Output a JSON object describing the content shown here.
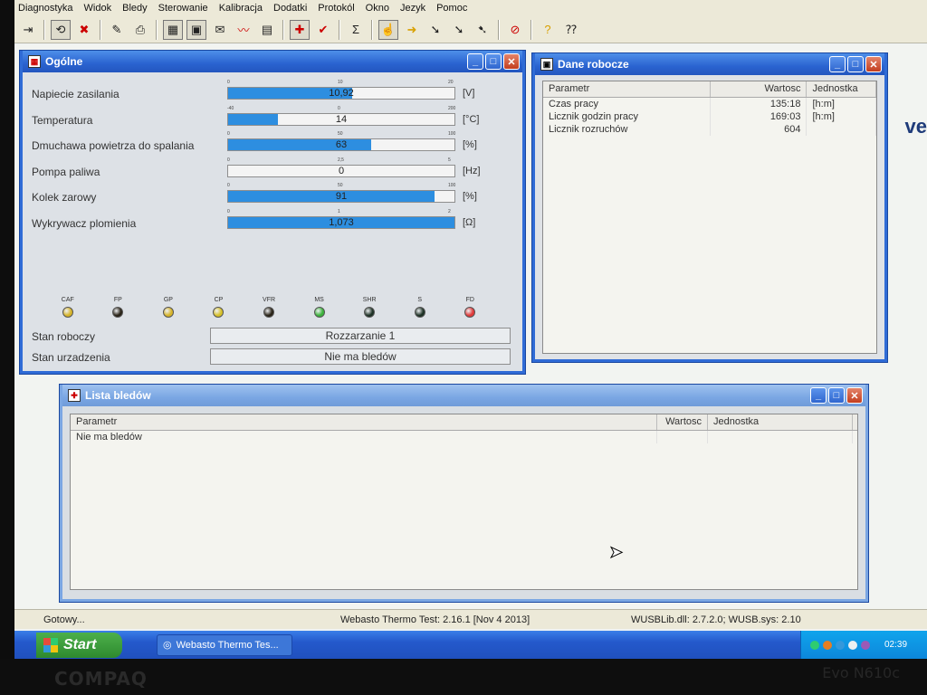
{
  "menu": [
    "Diagnostyka",
    "Widok",
    "Bledy",
    "Sterowanie",
    "Kalibracja",
    "Dodatki",
    "Protokól",
    "Okno",
    "Jezyk",
    "Pomoc"
  ],
  "ogolne": {
    "title": "Ogólne",
    "measurements": [
      {
        "label": "Napiecie zasilania",
        "value": "10,92",
        "unit": "[V]",
        "fill": 0.546,
        "scale": [
          "0",
          "10",
          "20"
        ]
      },
      {
        "label": "Temperatura",
        "value": "14",
        "unit": "[°C]",
        "fill": 0.22,
        "scale": [
          "-40",
          "0",
          "200"
        ]
      },
      {
        "label": "Dmuchawa powietrza do spalania",
        "value": "63",
        "unit": "[%]",
        "fill": 0.63,
        "scale": [
          "0",
          "50",
          "100"
        ]
      },
      {
        "label": "Pompa paliwa",
        "value": "0",
        "unit": "[Hz]",
        "fill": 0,
        "scale": [
          "0",
          "2,5",
          "5"
        ]
      },
      {
        "label": "Kolek zarowy",
        "value": "91",
        "unit": "[%]",
        "fill": 0.91,
        "scale": [
          "0",
          "50",
          "100"
        ]
      },
      {
        "label": "Wykrywacz plomienia",
        "value": "1,073",
        "unit": "[Ω]",
        "fill": 1.0,
        "scale": [
          "0",
          "1",
          "2"
        ]
      }
    ],
    "leds": [
      {
        "name": "CAF",
        "color": "#d6b42a"
      },
      {
        "name": "FP",
        "color": "#2a2418"
      },
      {
        "name": "GP",
        "color": "#d6b42a"
      },
      {
        "name": "CP",
        "color": "#d6c02a"
      },
      {
        "name": "VFR",
        "color": "#2a2418"
      },
      {
        "name": "MS",
        "color": "#3cb23c"
      },
      {
        "name": "SHR",
        "color": "#1e3226"
      },
      {
        "name": "S",
        "color": "#1e3226"
      },
      {
        "name": "FD",
        "color": "#e03a3a"
      }
    ],
    "stan_roboczy_label": "Stan roboczy",
    "stan_roboczy_value": "Rozzarzanie 1",
    "stan_urzadzenia_label": "Stan urzadzenia",
    "stan_urzadzenia_value": "Nie ma bledów"
  },
  "dane": {
    "title": "Dane robocze",
    "headers": [
      "Parametr",
      "Wartosc",
      "Jednostka"
    ],
    "rows": [
      [
        "Czas pracy",
        "135:18",
        "[h:m]"
      ],
      [
        "Licznik godzin pracy",
        "169:03",
        "[h:m]"
      ],
      [
        "Licznik rozruchów",
        "604",
        ""
      ]
    ]
  },
  "bledy": {
    "title": "Lista bledów",
    "headers": [
      "Parametr",
      "Wartosc",
      "Jednostka"
    ],
    "rows": [
      [
        "Nie ma bledów",
        "",
        ""
      ]
    ]
  },
  "status": {
    "left": "Gotowy...",
    "center": "Webasto Thermo Test: 2.16.1 [Nov  4 2013]",
    "right": "WUSBLib.dll: 2.7.2.0; WUSB.sys: 2.10"
  },
  "taskbar": {
    "start": "Start",
    "task": "Webasto Thermo Tes...",
    "clock": "02:39"
  },
  "backdrop": "ve",
  "bezel": {
    "brand": "COMPAQ",
    "model": "Evo N610c"
  }
}
